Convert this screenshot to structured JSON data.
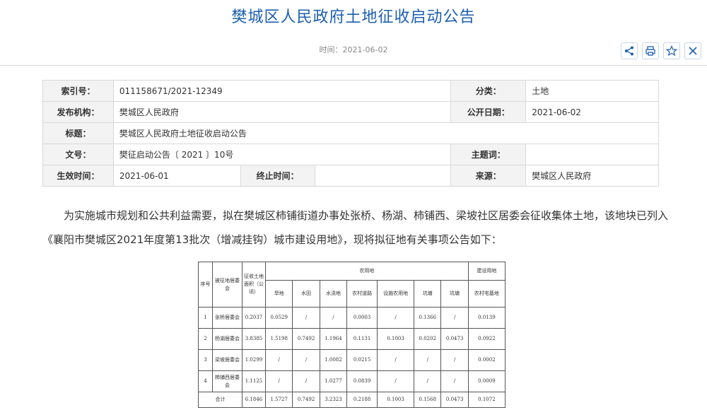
{
  "page": {
    "title": "樊城区人民政府土地征收启动公告",
    "time": "时间：2021-06-02"
  },
  "toolbar": {
    "share_icon": "share-icon",
    "print_icon": "print-icon",
    "favorite_icon": "star-icon",
    "close_icon": "close-icon",
    "accent_color": "#1c5fb0"
  },
  "info": {
    "index_label": "索引号：",
    "index_value": "011158671/2021-12349",
    "category_label": "分类：",
    "category_value": "土地",
    "publisher_label": "发布机构：",
    "publisher_value": "樊城区人民政府",
    "public_date_label": "公开日期：",
    "public_date_value": "2021-06-02",
    "title_label": "标题：",
    "title_value": "樊城区人民政府土地征收启动公告",
    "doc_no_label": "文号：",
    "doc_no_value": "樊征启动公告〔 2021 〕10号",
    "subject_label": "主题词：",
    "subject_value": "",
    "effective_label": "生效时间：",
    "effective_value": "2021-06-01",
    "end_label": "终止时间：",
    "end_value": "",
    "source_label": "来源：",
    "source_value": "樊城区人民政府"
  },
  "content": {
    "paragraph": "为实施城市规划和公共利益需要，拟在樊城区柿铺街道办事处张桥、杨湖、柿铺西、梁坡社区居委会征收集体土地，该地块已列入《襄阳市樊城区2021年度第13批次（增减挂钩）城市建设用地》，现将拟征地有关事项公告如下："
  },
  "land_table": {
    "header": {
      "seq": "序号",
      "name": "被征地居委会",
      "area": "征收土地面积（公顷）",
      "agri": "农用地",
      "construction": "建设用地",
      "cols": [
        "旱地",
        "水田",
        "水浇地",
        "农村道路",
        "设施农用地",
        "坑塘",
        "坑塘",
        "农村宅基地"
      ]
    },
    "rows": [
      {
        "seq": "1",
        "name": "张桥居委会",
        "area": "0.2037",
        "v": [
          "0.0529",
          "/",
          "/",
          "0.0003",
          "/",
          "0.1366",
          "/",
          "0.0139"
        ]
      },
      {
        "seq": "2",
        "name": "杨湖居委会",
        "area": "3.8385",
        "v": [
          "1.5198",
          "0.7492",
          "1.1964",
          "0.1131",
          "0.1003",
          "0.0202",
          "0.0473",
          "0.0922"
        ]
      },
      {
        "seq": "3",
        "name": "梁坡居委会",
        "area": "1.0299",
        "v": [
          "/",
          "/",
          "1.0082",
          "0.0215",
          "/",
          "/",
          "/",
          "0.0002"
        ]
      },
      {
        "seq": "4",
        "name": "柿铺西居委会",
        "area": "1.1125",
        "v": [
          "/",
          "/",
          "1.0277",
          "0.0839",
          "/",
          "/",
          "/",
          "0.0009"
        ]
      }
    ],
    "total": {
      "label": "合计",
      "area": "6.1846",
      "v": [
        "1.5727",
        "0.7492",
        "3.2323",
        "0.2188",
        "0.1003",
        "0.1568",
        "0.0473",
        "0.1072"
      ]
    }
  }
}
